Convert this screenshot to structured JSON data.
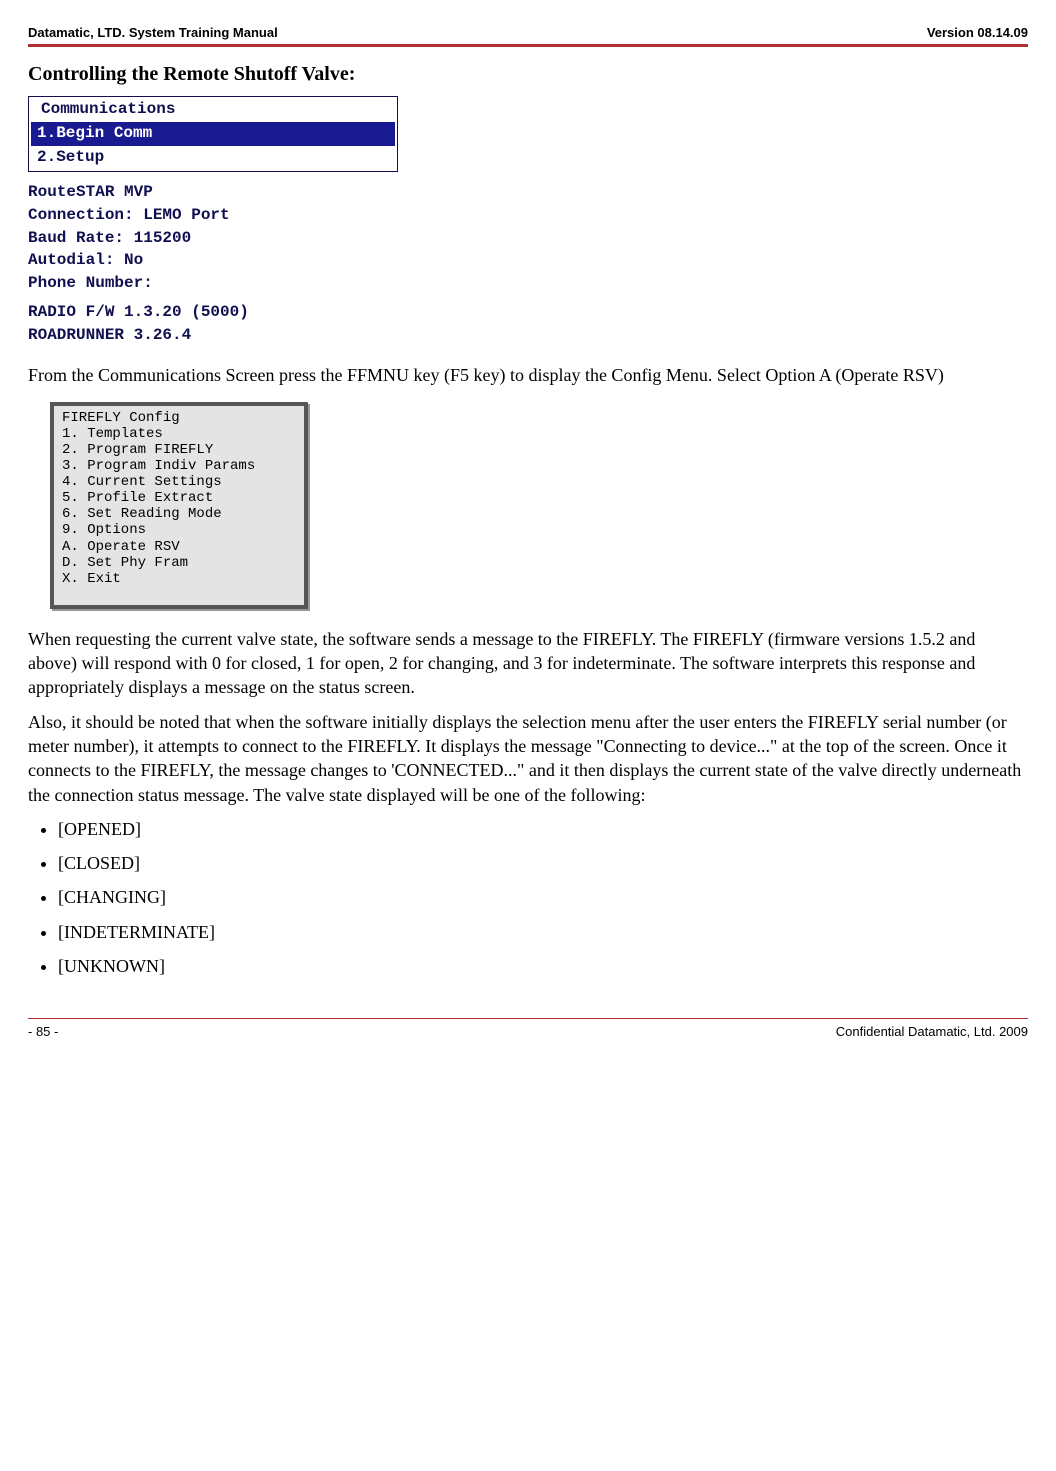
{
  "header": {
    "left": "Datamatic, LTD. System Training  Manual",
    "right": "Version 08.14.09"
  },
  "section_title": "Controlling the Remote Shutoff Valve:",
  "comm_screen": {
    "group_label": "Communications",
    "item_selected": "1.Begin Comm",
    "item_2": "2.Setup",
    "line_product": "RouteSTAR MVP",
    "line_connection": "Connection: LEMO Port",
    "line_baud": "Baud Rate: 115200",
    "line_autodial": "Autodial: No",
    "line_phone": "Phone Number:",
    "line_radio": "RADIO F/W    1.3.20 (5000)",
    "line_roadrunner": "ROADRUNNER   3.26.4"
  },
  "para_after_comm": "From the Communications Screen press the FFMNU key (F5 key) to display the Config Menu. Select Option A (Operate RSV)",
  "config_menu": {
    "title": "FIREFLY Config",
    "l1": "1. Templates",
    "l2": "2. Program FIREFLY",
    "l3": "3. Program Indiv Params",
    "l4": "4. Current Settings",
    "l5": "5. Profile Extract",
    "l6": "6. Set Reading Mode",
    "l9": "9. Options",
    "lA": "A. Operate RSV",
    "lD": "D. Set Phy Fram",
    "lX": "X. Exit"
  },
  "para_request": "When requesting the current valve state, the software sends a message to the FIREFLY.  The FIREFLY (firmware versions 1.5.2 and above) will respond with 0 for closed, 1 for open, 2 for changing, and 3 for indeterminate.  The software interprets this response and appropriately displays a message on the status screen.",
  "para_note": "Also, it should be noted that when the software initially displays the selection menu after the user enters the FIREFLY serial number (or meter number), it attempts to connect to the FIREFLY.  It displays the message \"Connecting to device...\" at the top of the screen. Once it connects to the FIREFLY, the message changes to 'CONNECTED...\" and it then displays the current state of the valve directly underneath the connection status message.  The valve state displayed will be one of the following:",
  "states": {
    "s0": "[OPENED]",
    "s1": "[CLOSED]",
    "s2": "[CHANGING]",
    "s3": "[INDETERMINATE]",
    "s4": "[UNKNOWN]"
  },
  "footer": {
    "left": "- 85 -",
    "right": "Confidential Datamatic, Ltd. 2009"
  }
}
